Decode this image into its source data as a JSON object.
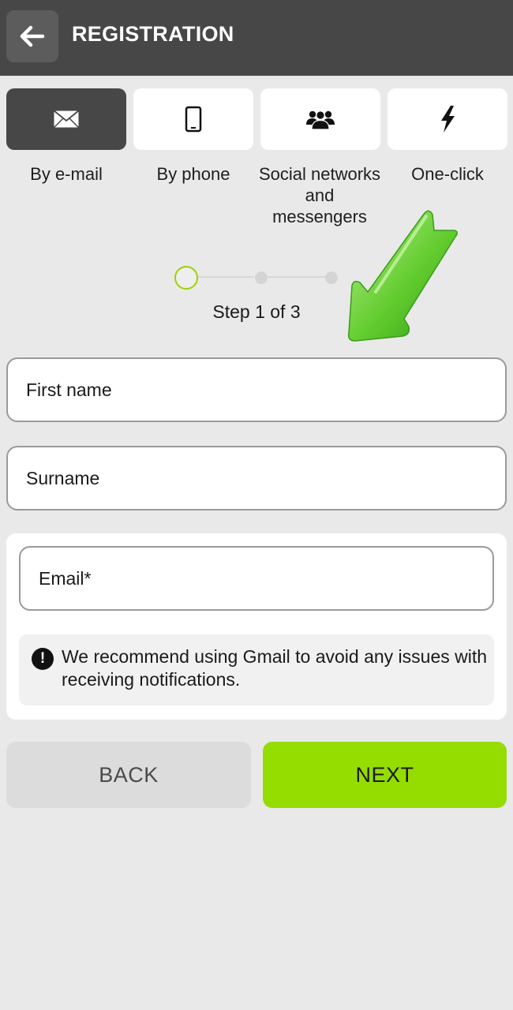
{
  "header": {
    "title": "REGISTRATION",
    "back_icon": "arrow-left-icon"
  },
  "tabs": [
    {
      "label": "By e-mail",
      "icon": "envelope-icon",
      "active": true
    },
    {
      "label": "By phone",
      "icon": "phone-icon",
      "active": false
    },
    {
      "label": "Social networks and messengers",
      "icon": "users-icon",
      "active": false
    },
    {
      "label": "One-click",
      "icon": "lightning-icon",
      "active": false
    }
  ],
  "stepper": {
    "current_step": 1,
    "total_steps": 3,
    "text": "Step 1 of 3"
  },
  "form": {
    "first_name_placeholder": "First name",
    "surname_placeholder": "Surname",
    "email_placeholder": "Email*",
    "notice_text": "We recommend using Gmail to avoid any issues with receiving notifications."
  },
  "buttons": {
    "back_label": "BACK",
    "next_label": "NEXT"
  },
  "colors": {
    "header_bg": "#474747",
    "accent_green": "#95dd00",
    "page_bg": "#e9e9e9"
  }
}
